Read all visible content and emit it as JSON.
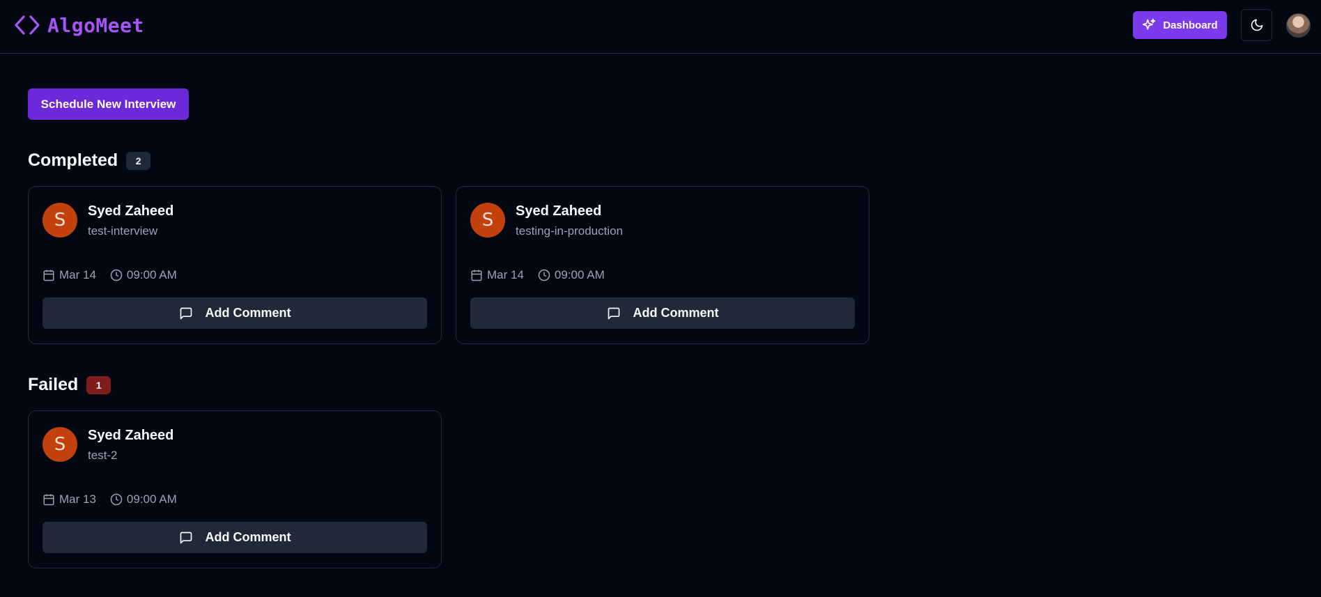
{
  "header": {
    "brand": "AlgoMeet",
    "dashboard_label": "Dashboard",
    "icons": {
      "logo": "code-brackets-icon",
      "dashboard": "sparkles-icon",
      "theme": "moon-icon"
    },
    "accent": "#a855f7"
  },
  "main": {
    "schedule_label": "Schedule New Interview",
    "sections": [
      {
        "title": "Completed",
        "count": "2",
        "cards": [
          {
            "initial": "S",
            "name": "Syed Zaheed",
            "title": "test-interview",
            "date": "Mar 14",
            "time": "09:00 AM",
            "comment_label": "Add Comment"
          },
          {
            "initial": "S",
            "name": "Syed Zaheed",
            "title": "testing-in-production",
            "date": "Mar 14",
            "time": "09:00 AM",
            "comment_label": "Add Comment"
          }
        ]
      },
      {
        "title": "Failed",
        "count": "1",
        "cards": [
          {
            "initial": "S",
            "name": "Syed Zaheed",
            "title": "test-2",
            "date": "Mar 13",
            "time": "09:00 AM",
            "comment_label": "Add Comment"
          }
        ]
      }
    ]
  },
  "colors": {
    "background": "#030712",
    "primary_button": "#6d28d9",
    "avatar": "#c2410c",
    "failed_badge": "#7f1d1d"
  }
}
